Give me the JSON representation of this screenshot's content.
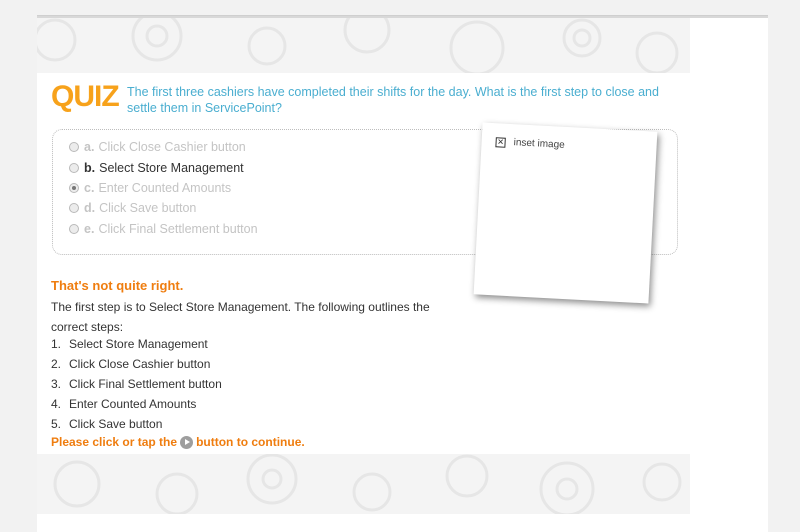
{
  "quiz": {
    "title": "QUIZ",
    "question": "The first three cashiers have completed their shifts for the day. What is the first step to close and settle them in ServicePoint?"
  },
  "options": [
    {
      "letter": "a.",
      "label": "Click Close Cashier button",
      "state": "disabled"
    },
    {
      "letter": "b.",
      "label": "Select Store Management",
      "state": "active"
    },
    {
      "letter": "c.",
      "label": "Enter Counted Amounts",
      "state": "selected"
    },
    {
      "letter": "d.",
      "label": "Click Save button",
      "state": "disabled"
    },
    {
      "letter": "e.",
      "label": "Click Final Settlement button",
      "state": "disabled"
    }
  ],
  "inset": {
    "label": "inset image",
    "icon": "broken-image-icon"
  },
  "feedback": {
    "title": "That's not quite right.",
    "text": "The first step is to Select Store Management. The following outlines the correct steps:",
    "steps": [
      {
        "num": "1.",
        "text": "Select Store Management"
      },
      {
        "num": "2.",
        "text": "Click Close Cashier button"
      },
      {
        "num": "3.",
        "text": "Click Final Settlement button"
      },
      {
        "num": "4.",
        "text": "Enter Counted Amounts"
      },
      {
        "num": "5.",
        "text": "Click Save button"
      }
    ],
    "continue_before": "Please click or tap the",
    "continue_after": "button to continue.",
    "continue_icon": "play-icon"
  },
  "colors": {
    "accent": "#f7a21b",
    "question": "#4aaed0",
    "feedback": "#ef7d0f"
  }
}
